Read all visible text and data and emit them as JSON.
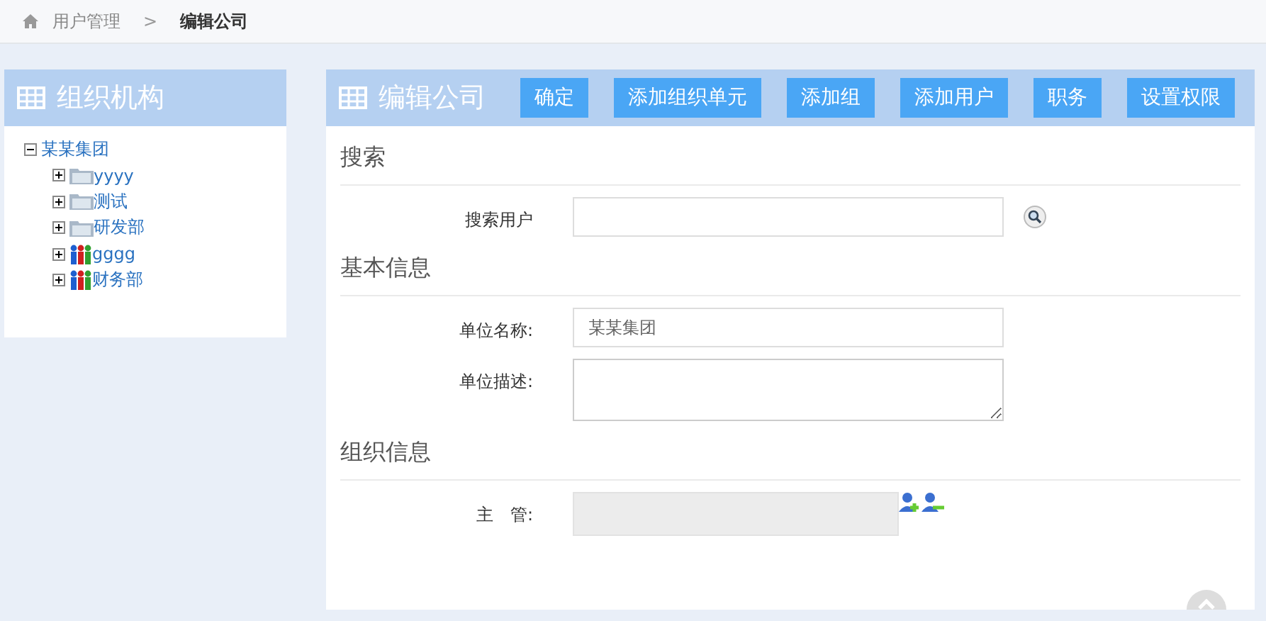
{
  "breadcrumb": {
    "items": [
      {
        "label": "用户管理",
        "current": false
      },
      {
        "label": "编辑公司",
        "current": true
      }
    ],
    "separator": ">"
  },
  "sidebar": {
    "title": "组织机构",
    "tree": [
      {
        "label": "某某集团",
        "expanded": true,
        "children": [
          {
            "label": "yyyy",
            "kind": "folder",
            "expanded": false
          },
          {
            "label": "测试",
            "kind": "folder",
            "expanded": false
          },
          {
            "label": "研发部",
            "kind": "folder",
            "expanded": false
          },
          {
            "label": "gggg",
            "kind": "group",
            "expanded": false
          },
          {
            "label": "财务部",
            "kind": "group",
            "expanded": false
          }
        ]
      }
    ]
  },
  "main": {
    "title": "编辑公司",
    "buttons": [
      "确定",
      "添加组织单元",
      "添加组",
      "添加用户",
      "职务",
      "设置权限"
    ],
    "sections": [
      {
        "title": "搜索",
        "fields": [
          {
            "label": "搜索用户",
            "kind": "search"
          }
        ]
      },
      {
        "title": "基本信息",
        "fields": [
          {
            "label": "单位名称:",
            "kind": "text",
            "value": "某某集团"
          },
          {
            "label": "单位描述:",
            "kind": "textarea"
          }
        ]
      },
      {
        "title": "组织信息",
        "fields": [
          {
            "label": "主　管:",
            "kind": "readonly"
          }
        ]
      }
    ]
  }
}
